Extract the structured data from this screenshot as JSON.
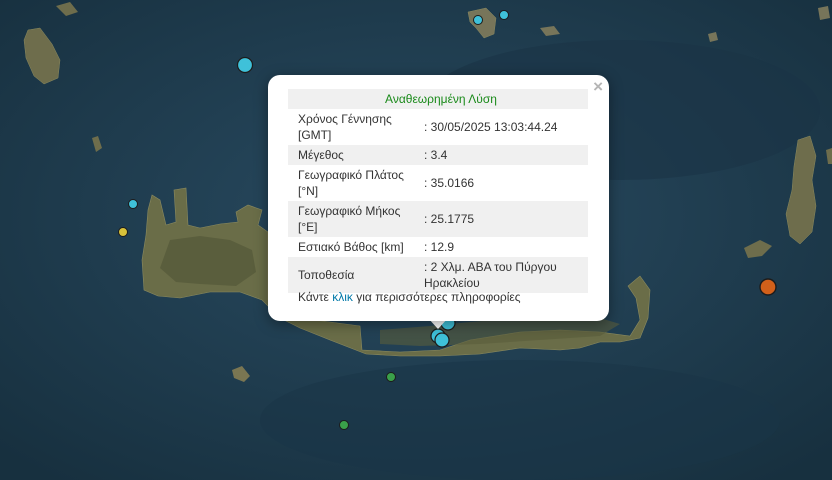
{
  "popup": {
    "header": "Αναθεωρημένη Λύση",
    "close_icon": "close-icon",
    "rows": [
      {
        "label": "Χρόνος Γέννησης [GMT]",
        "value": ": 30/05/2025 13:03:44.24"
      },
      {
        "label": "Μέγεθος",
        "value": ": 3.4"
      },
      {
        "label": "Γεωγραφικό Πλάτος [°N]",
        "value": ": 35.0166"
      },
      {
        "label": "Γεωγραφικό Μήκος [°E]",
        "value": ": 25.1775"
      },
      {
        "label": "Εστιακό Βάθος [km]",
        "value": ": 12.9"
      },
      {
        "label": "Τοποθεσία",
        "value": ": 2 Χλμ. ΑΒΑ του Πύργου Ηρακλείου"
      }
    ],
    "more_prefix": "Κάντε",
    "more_link": "κλικ",
    "more_suffix": "για περισσότερες πληροφορίες"
  },
  "colors": {
    "sea": "#1f3d52",
    "land": "#6b6e4a",
    "marker_cyan": "#3fc1d9",
    "marker_yellow": "#d8c23a",
    "marker_green": "#3aa04a",
    "marker_orange": "#d2601a",
    "popup_header": "#1a8a1a",
    "link": "#0078a8"
  }
}
